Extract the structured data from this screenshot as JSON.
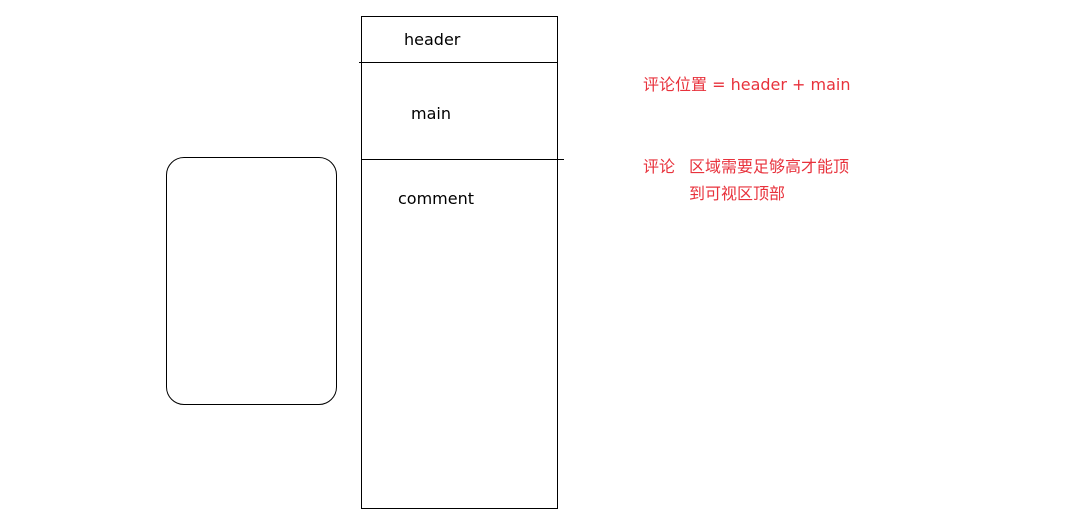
{
  "diagram": {
    "sections": {
      "header": "header",
      "main": "main",
      "comment": "comment"
    },
    "notes": {
      "position_formula": "评论位置 = header + main",
      "comment_word": "评论",
      "height_line1": "区域需要足够高才能顶",
      "height_line2": "到可视区顶部"
    },
    "colors": {
      "note": "#e8323c",
      "outline": "#000000"
    }
  }
}
